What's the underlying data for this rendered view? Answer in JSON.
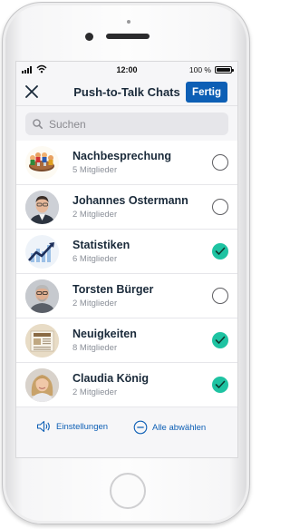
{
  "status_bar": {
    "time": "12:00",
    "battery_text": "100 %"
  },
  "nav": {
    "title": "Push-to-Talk Chats",
    "done_label": "Fertig",
    "close_icon": "close-icon"
  },
  "search": {
    "placeholder": "Suchen",
    "value": ""
  },
  "chats": [
    {
      "name": "Nachbesprechung",
      "members": "5 Mitglieder",
      "selected": false,
      "avatar": "meeting-illustration"
    },
    {
      "name": "Johannes Ostermann",
      "members": "2 Mitglieder",
      "selected": false,
      "avatar": "person-photo"
    },
    {
      "name": "Statistiken",
      "members": "6 Mitglieder",
      "selected": true,
      "avatar": "chart-illustration"
    },
    {
      "name": "Torsten Bürger",
      "members": "2 Mitglieder",
      "selected": false,
      "avatar": "person-photo"
    },
    {
      "name": "Neuigkeiten",
      "members": "8 Mitglieder",
      "selected": true,
      "avatar": "newspaper-illustration"
    },
    {
      "name": "Claudia König",
      "members": "2 Mitglieder",
      "selected": true,
      "avatar": "person-photo"
    }
  ],
  "footer": {
    "settings_label": "Einstellungen",
    "deselect_all_label": "Alle abwählen"
  },
  "colors": {
    "accent": "#0d5fb5",
    "check_on": "#1ec3a2",
    "title_text": "#1a2a3a"
  }
}
